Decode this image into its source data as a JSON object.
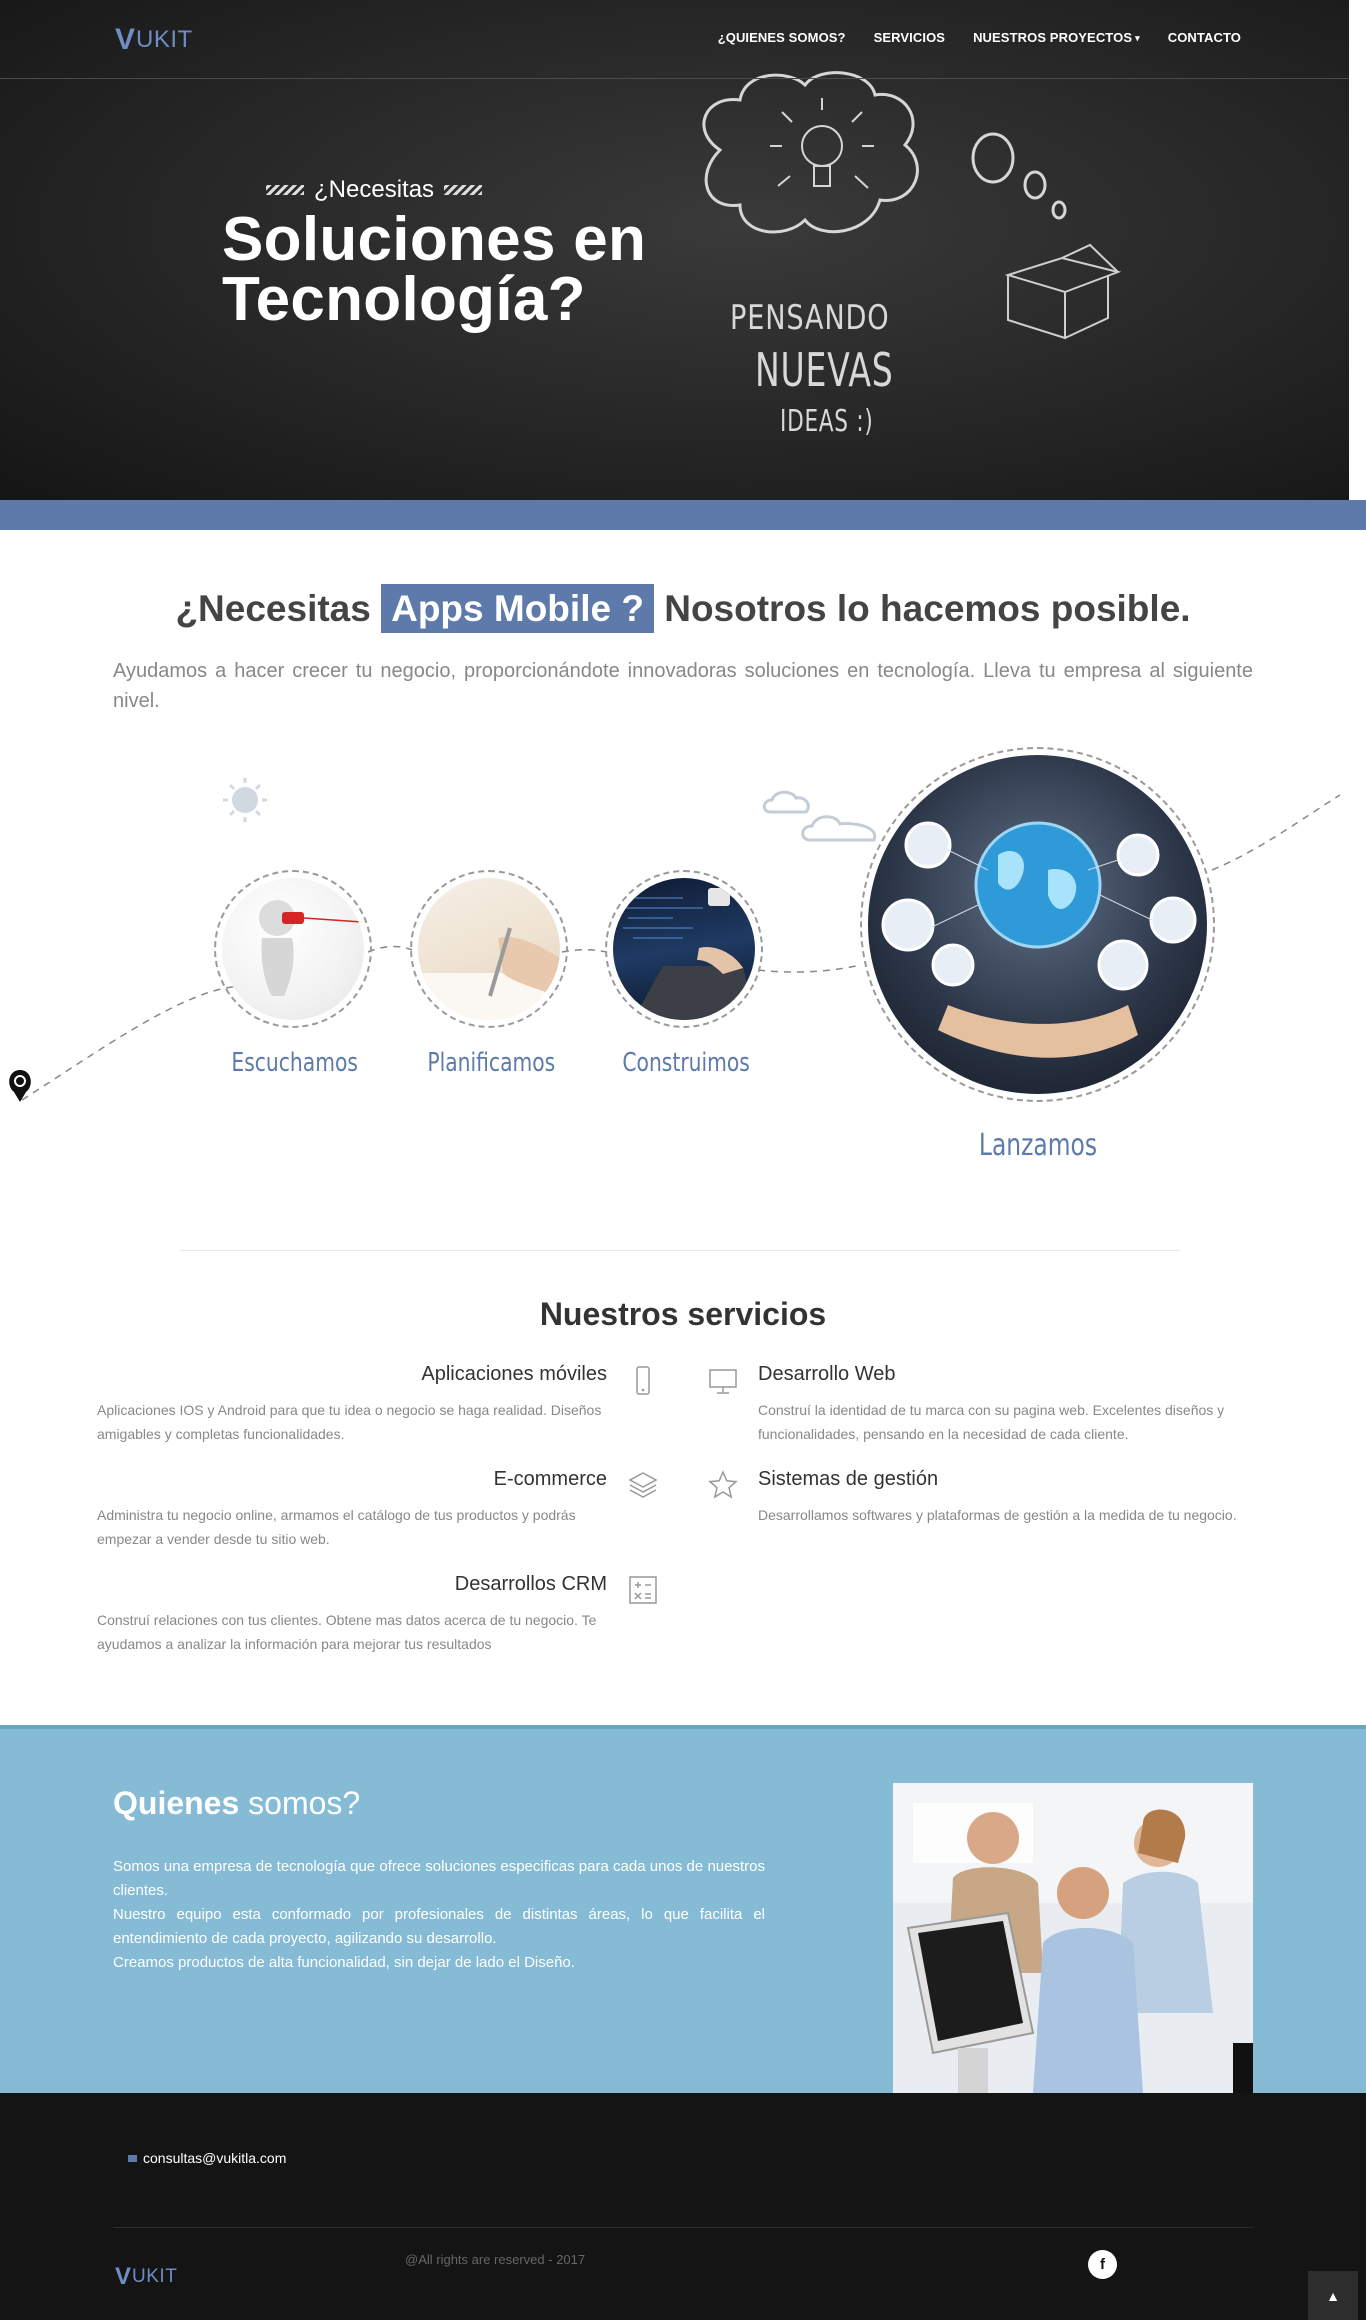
{
  "brand": {
    "logo_mark": "V",
    "logo_text": "UKIT"
  },
  "nav": {
    "items": [
      {
        "label": "¿QUIENES SOMOS?"
      },
      {
        "label": "SERVICIOS"
      },
      {
        "label": "NUESTROS PROYECTOS",
        "has_dropdown": true,
        "caret": "▾"
      },
      {
        "label": "CONTACTO"
      }
    ]
  },
  "hero": {
    "kicker": "¿Necesitas",
    "title_line1": "Soluciones en",
    "title_line2": "Tecnología?",
    "chalk_line1": "PENSANDO",
    "chalk_line2": "NUEVAS",
    "chalk_line3": "IDEAS :)"
  },
  "apps": {
    "title_before": "¿Necesitas",
    "title_highlight": "Apps Mobile ?",
    "title_after": "Nosotros lo hacemos posible.",
    "subtitle": "Ayudamos a hacer crecer tu negocio, proporcionándote innovadoras soluciones en tecnología. Lleva tu empresa al siguiente nivel."
  },
  "process": {
    "steps": [
      {
        "label": "Escuchamos"
      },
      {
        "label": "Planificamos"
      },
      {
        "label": "Construimos"
      },
      {
        "label": "Lanzamos"
      }
    ]
  },
  "services": {
    "title_light": "Nuestros",
    "title_bold": "servicios",
    "items": [
      {
        "title": "Aplicaciones móviles",
        "desc": "Aplicaciones IOS y Android para que tu idea o negocio se haga realidad. Diseños amigables y completas funcionalidades.",
        "icon": "mobile-icon"
      },
      {
        "title": "E-commerce",
        "desc": "Administra tu negocio online, armamos el catálogo de tus productos y podrás empezar a vender desde tu sitio web.",
        "icon": "layers-icon"
      },
      {
        "title": "Desarrollos CRM",
        "desc": "Construí relaciones con tus clientes. Obtene mas datos acerca de tu negocio. Te ayudamos a analizar la información para mejorar tus resultados",
        "icon": "calculator-icon"
      },
      {
        "title": "Desarrollo Web",
        "desc": "Construí la identidad de tu marca con su pagina web. Excelentes diseños y funcionalidades, pensando en la necesidad de cada cliente.",
        "icon": "monitor-icon"
      },
      {
        "title": "Sistemas de gestión",
        "desc": "Desarrollamos softwares y plataformas de gestión a la medida de tu negocio.",
        "icon": "star-icon"
      }
    ]
  },
  "about": {
    "title_bold": "Quienes",
    "title_light": "somos?",
    "line1": "Somos una empresa de tecnología que ofrece soluciones especificas para cada unos de nuestros clientes.",
    "line2": "Nuestro equipo esta conformado por profesionales de distintas áreas, lo que facilita el entendimiento de cada proyecto, agilizando su desarrollo.",
    "line3": "Creamos productos de alta funcionalidad, sin dejar de lado el Diseño."
  },
  "footer": {
    "email": "consultas@vukitla.com",
    "copyright": "@All rights are reserved - 2017",
    "social_label": "f",
    "to_top_icon": "▲"
  },
  "colors": {
    "accent": "#5e7aab",
    "about_bg": "#86bbd6",
    "footer_bg": "#141414",
    "hero_bg": "#262626"
  }
}
